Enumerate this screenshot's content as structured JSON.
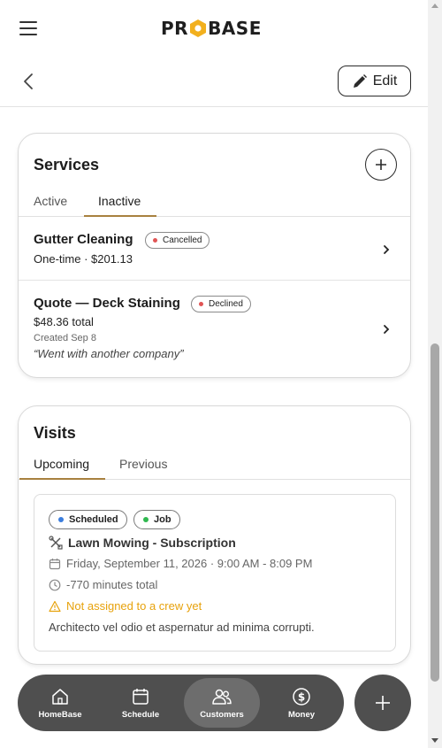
{
  "header": {
    "logo_text_left": "PR",
    "logo_text_right": "BASE",
    "menu_icon": "hamburger-icon"
  },
  "subheader": {
    "back_icon": "chevron-left-icon",
    "edit_label": "Edit",
    "edit_icon": "pencil-icon"
  },
  "services": {
    "title": "Services",
    "tabs": [
      {
        "label": "Active",
        "active": false
      },
      {
        "label": "Inactive",
        "active": true
      }
    ],
    "items": [
      {
        "name": "Gutter Cleaning",
        "status": "Cancelled",
        "status_color": "#e05454",
        "detail": "One-time · $201.13"
      },
      {
        "name": "Quote — Deck Staining",
        "status": "Declined",
        "status_color": "#e05454",
        "detail": "$48.36 total",
        "created": "Created Sep 8",
        "note": "“Went with another company”"
      }
    ]
  },
  "visits": {
    "title": "Visits",
    "tabs": [
      {
        "label": "Upcoming",
        "active": true
      },
      {
        "label": "Previous",
        "active": false
      }
    ],
    "visit": {
      "badges": [
        {
          "label": "Scheduled",
          "color": "#3b7ddd"
        },
        {
          "label": "Job",
          "color": "#2fb84f"
        }
      ],
      "service": "Lawn Mowing - Subscription",
      "datetime": "Friday, September 11, 2026 · 9:00 AM - 8:09 PM",
      "duration": "-770 minutes total",
      "warning": "Not assigned to a crew yet",
      "description": "Architecto vel odio et aspernatur ad minima corrupti."
    }
  },
  "nav": {
    "items": [
      {
        "label": "HomeBase",
        "icon": "home-icon",
        "active": false
      },
      {
        "label": "Schedule",
        "icon": "calendar-icon",
        "active": false
      },
      {
        "label": "Customers",
        "icon": "users-icon",
        "active": true
      },
      {
        "label": "Money",
        "icon": "dollar-icon",
        "active": false
      }
    ],
    "fab_icon": "plus-icon"
  },
  "colors": {
    "accent": "#a8813f",
    "logo_yellow": "#f2b01e",
    "nav_bg": "#4f4f4f",
    "warning": "#e7a20c"
  }
}
